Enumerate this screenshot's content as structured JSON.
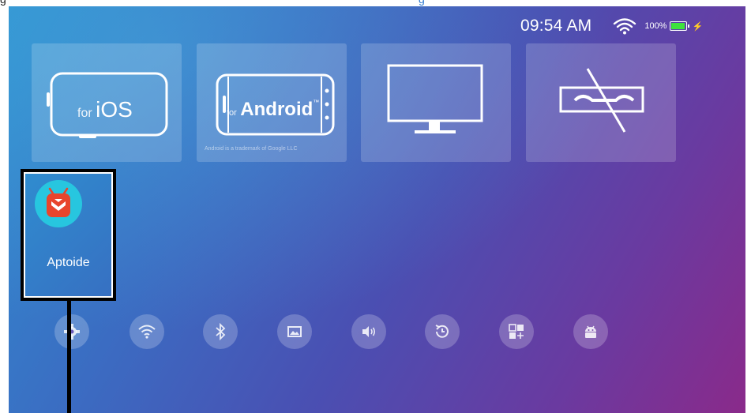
{
  "page_top_text": {
    "left": "g",
    "right": "g"
  },
  "status_bar": {
    "time": "09:54 AM",
    "battery_percent": "100%",
    "battery_level": 1.0,
    "battery_color": "#3de23d",
    "wifi_icon": "wifi-icon",
    "charging_icon": "charging-bolt-icon"
  },
  "source_tiles": {
    "ios": {
      "for_label": "for",
      "brand": "iOS"
    },
    "android": {
      "for_label": "for",
      "brand": "Android",
      "tm": "™",
      "trademark_note": "Android is a trademark of Google LLC"
    },
    "display": {
      "icon": "monitor-icon"
    },
    "no_signal": {
      "icon": "no-signal-cable-icon"
    }
  },
  "apps": [
    {
      "label": "Aptoide",
      "icon": "aptoide-app-icon"
    }
  ],
  "settings_icons": [
    "settings-gear-icon",
    "wifi-icon",
    "bluetooth-icon",
    "image-icon",
    "volume-icon",
    "restore-clock-icon",
    "apps-grid-icon",
    "android-robot-icon"
  ]
}
